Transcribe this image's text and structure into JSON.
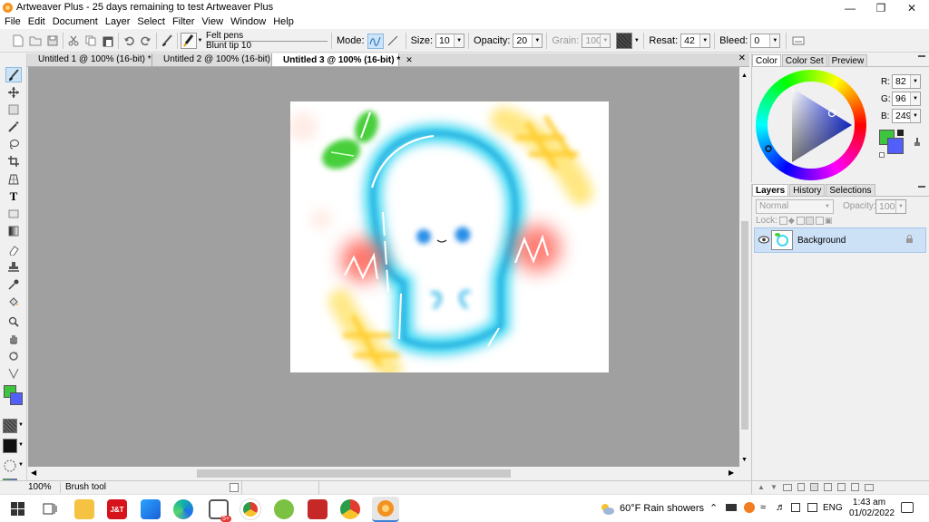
{
  "window": {
    "title": "Artweaver Plus - 25 days remaining to test Artweaver Plus"
  },
  "menu": [
    "File",
    "Edit",
    "Document",
    "Layer",
    "Select",
    "Filter",
    "View",
    "Window",
    "Help"
  ],
  "toolbar": {
    "brush_category": "Felt pens",
    "brush_variant": "Blunt tip 10",
    "mode_label": "Mode:",
    "size_label": "Size:",
    "size_value": "10",
    "opacity_label": "Opacity:",
    "opacity_value": "20",
    "grain_label": "Grain:",
    "grain_value": "100",
    "resat_label": "Resat:",
    "resat_value": "42",
    "bleed_label": "Bleed:",
    "bleed_value": "0"
  },
  "tabs": [
    {
      "label": "Untitled 1 @ 100% (16-bit) *"
    },
    {
      "label": "Untitled 2 @ 100% (16-bit)"
    },
    {
      "label": "Untitled 3 @ 100% (16-bit) *"
    }
  ],
  "status": {
    "zoom": "100%",
    "tool": "Brush tool"
  },
  "color_panel": {
    "tabs": [
      "Color",
      "Color Set",
      "Preview"
    ],
    "r_label": "R:",
    "r_value": "82",
    "g_label": "G:",
    "g_value": "96",
    "b_label": "B:",
    "b_value": "249",
    "primary_color": "#5260f9",
    "secondary_color": "#3ec43e"
  },
  "layers_panel": {
    "tabs": [
      "Layers",
      "History",
      "Selections"
    ],
    "blend_mode": "Normal",
    "opacity_label": "Opacity:",
    "opacity_value": "100",
    "lock_label": "Lock:",
    "layers": [
      {
        "name": "Background"
      }
    ]
  },
  "taskbar": {
    "weather": "60°F  Rain showers",
    "language": "ENG",
    "time": "1:43 am",
    "date": "01/02/2022"
  }
}
